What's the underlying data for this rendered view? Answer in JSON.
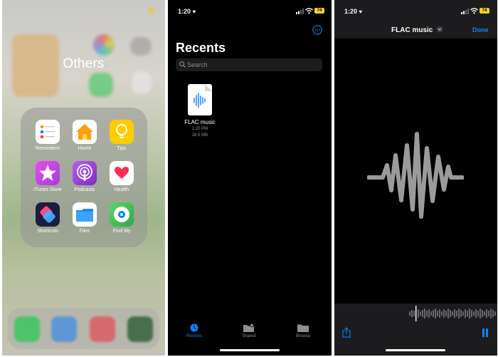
{
  "panel1": {
    "folder_title": "Others",
    "apps": [
      {
        "label": "Reminders",
        "icon": "reminders-icon"
      },
      {
        "label": "Home",
        "icon": "home-icon"
      },
      {
        "label": "Tips",
        "icon": "tips-icon"
      },
      {
        "label": "iTunes Store",
        "icon": "itunes-store-icon"
      },
      {
        "label": "Podcasts",
        "icon": "podcasts-icon"
      },
      {
        "label": "Health",
        "icon": "health-icon"
      },
      {
        "label": "Shortcuts",
        "icon": "shortcuts-icon"
      },
      {
        "label": "Files",
        "icon": "files-icon"
      },
      {
        "label": "Find My",
        "icon": "find-my-icon"
      }
    ]
  },
  "panel2": {
    "status_time": "1:20",
    "battery": "74",
    "title": "Recents",
    "search_placeholder": "Search",
    "file": {
      "name": "FLAC music",
      "time": "1:20 PM",
      "size": "28.5 MB"
    },
    "tabs": [
      {
        "label": "Recents",
        "icon": "clock-icon",
        "active": true
      },
      {
        "label": "Shared",
        "icon": "shared-folder-icon",
        "active": false
      },
      {
        "label": "Browse",
        "icon": "folder-icon",
        "active": false
      }
    ]
  },
  "panel3": {
    "status_time": "1:20",
    "battery": "74",
    "title": "FLAC music",
    "done_label": "Done"
  },
  "colors": {
    "ios_blue": "#0a84ff",
    "battery_yellow": "#f2d31b",
    "background_dark": "#000000",
    "bar_gray": "#1c1c1e"
  }
}
